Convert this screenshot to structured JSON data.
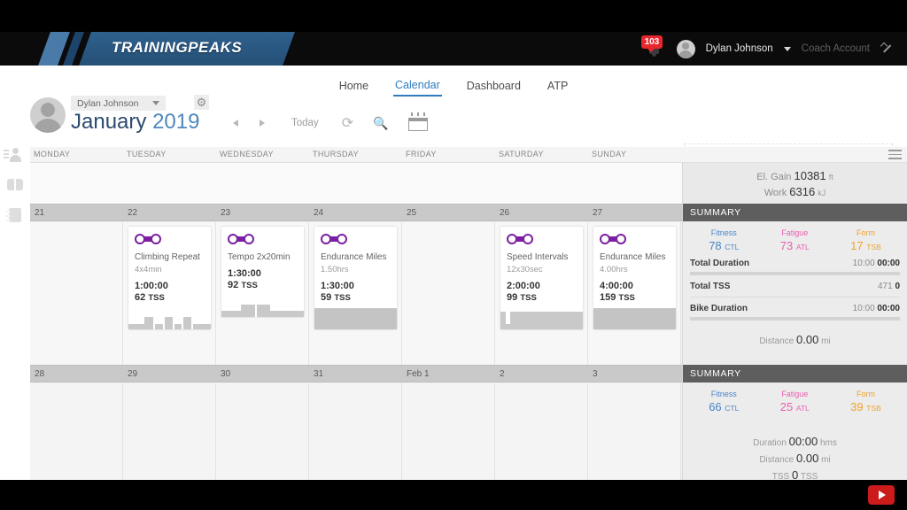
{
  "brand": {
    "logo_text": "TRAININGPEAKS"
  },
  "topbar": {
    "notification_count": "103",
    "user_name": "Dylan Johnson",
    "coach_account": "Coach Account"
  },
  "nav": {
    "tabs": [
      {
        "label": "Home",
        "active": false
      },
      {
        "label": "Calendar",
        "active": true
      },
      {
        "label": "Dashboard",
        "active": false
      },
      {
        "label": "ATP",
        "active": false
      }
    ]
  },
  "athlete": {
    "name": "Dylan Johnson"
  },
  "calendar": {
    "month": "January",
    "year": "2019",
    "today_label": "Today",
    "day_names": [
      "MONDAY",
      "TUESDAY",
      "WEDNESDAY",
      "THURSDAY",
      "FRIDAY",
      "SATURDAY",
      "SUNDAY"
    ]
  },
  "prev_week_summary": {
    "el_gain_label": "El. Gain",
    "el_gain_value": "10381",
    "el_gain_unit": "ft",
    "work_label": "Work",
    "work_value": "6316",
    "work_unit": "kJ"
  },
  "weeks": [
    {
      "dates": [
        "21",
        "22",
        "23",
        "24",
        "25",
        "26",
        "27"
      ],
      "workouts": [
        {
          "day": 1,
          "title": "Climbing Repeat",
          "subtitle": "4x4min",
          "duration": "1:00:00",
          "tss_value": "62",
          "tss_unit": "TSS",
          "graph": "intervals"
        },
        {
          "day": 2,
          "title": "Tempo 2x20min",
          "subtitle": "",
          "duration": "1:30:00",
          "tss_value": "92",
          "tss_unit": "TSS",
          "graph": "blocks"
        },
        {
          "day": 3,
          "title": "Endurance Miles",
          "subtitle": "1.50hrs",
          "duration": "1:30:00",
          "tss_value": "59",
          "tss_unit": "TSS",
          "graph": "flat"
        },
        {
          "day": 5,
          "title": "Speed Intervals",
          "subtitle": "12x30sec",
          "duration": "2:00:00",
          "tss_value": "99",
          "tss_unit": "TSS",
          "graph": "spikes"
        },
        {
          "day": 6,
          "title": "Endurance Miles",
          "subtitle": "4.00hrs",
          "duration": "4:00:00",
          "tss_value": "159",
          "tss_unit": "TSS",
          "graph": "flat"
        }
      ],
      "summary": {
        "header": "SUMMARY",
        "fitness_label": "Fitness",
        "fitness_value": "78",
        "fitness_unit": "CTL",
        "fatigue_label": "Fatigue",
        "fatigue_value": "73",
        "fatigue_unit": "ATL",
        "form_label": "Form",
        "form_value": "17",
        "form_unit": "TSB",
        "total_duration_label": "Total Duration",
        "total_duration_planned": "10:00",
        "total_duration_actual": "00:00",
        "total_tss_label": "Total TSS",
        "total_tss_planned": "471",
        "total_tss_actual": "0",
        "bike_duration_label": "Bike Duration",
        "bike_duration_planned": "10:00",
        "bike_duration_actual": "00:00",
        "distance_label": "Distance",
        "distance_value": "0.00",
        "distance_unit": "mi"
      }
    },
    {
      "dates": [
        "28",
        "29",
        "30",
        "31",
        "Feb 1",
        "2",
        "3"
      ],
      "workouts": [],
      "summary": {
        "header": "SUMMARY",
        "fitness_label": "Fitness",
        "fitness_value": "66",
        "fitness_unit": "CTL",
        "fatigue_label": "Fatigue",
        "fatigue_value": "25",
        "fatigue_unit": "ATL",
        "form_label": "Form",
        "form_value": "39",
        "form_unit": "TSB",
        "duration_label": "Duration",
        "duration_value": "00:00",
        "duration_unit": "hms",
        "distance_label": "Distance",
        "distance_value": "0.00",
        "distance_unit": "mi",
        "tss_label": "TSS",
        "tss_value": "0",
        "tss_unit": "TSS"
      }
    }
  ],
  "colors": {
    "fitness": "#4a86c8",
    "fatigue": "#e85fb0",
    "form": "#f0a32a",
    "accent_blue": "#2f7cc0",
    "workout_purple": "#7a1fa2",
    "badge_red": "#e8262d"
  }
}
